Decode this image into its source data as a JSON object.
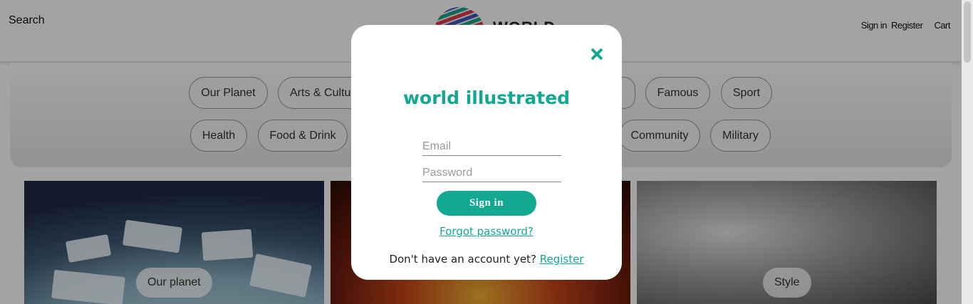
{
  "header": {
    "search_label": "Search",
    "logo_text": "WORLD",
    "signin_label": "Sign in",
    "register_label": "Register",
    "cart_label": "Cart"
  },
  "categories": {
    "row1": [
      "Our Planet",
      "Arts & Culture",
      "",
      "",
      "",
      "Famous",
      "Sport"
    ],
    "row2": [
      "Health",
      "Food & Drink",
      "",
      "",
      "",
      "Community",
      "Military"
    ]
  },
  "tiles": [
    {
      "label": "Our planet"
    },
    {
      "label": ""
    },
    {
      "label": "Style"
    }
  ],
  "modal": {
    "title": "world illustrated",
    "email_placeholder": "Email",
    "password_placeholder": "Password",
    "signin_button": "Sign in",
    "forgot_link": "Forgot password?",
    "register_prompt": "Don't have an account yet?",
    "register_link": "Register"
  },
  "colors": {
    "accent": "#12a892",
    "overlay": "rgba(0,0,0,0.36)"
  }
}
